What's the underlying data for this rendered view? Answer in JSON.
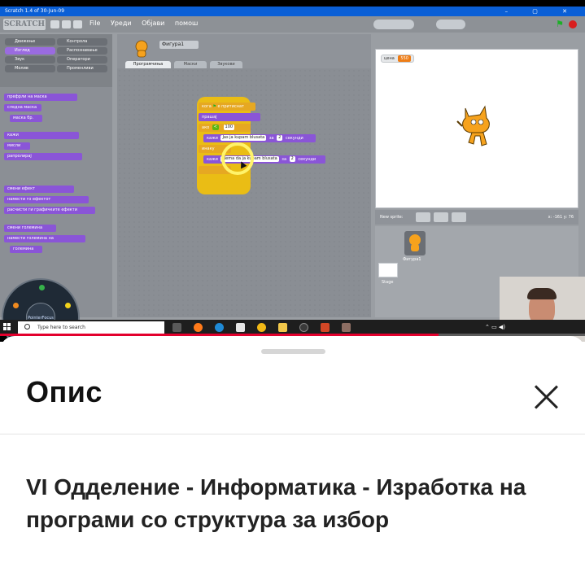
{
  "video": {
    "window_title": "Scratch 1.4 of 30-Jun-09",
    "menu": [
      "File",
      "Уреди",
      "Објави",
      "помош"
    ],
    "sprite_name": "Фигура1",
    "tabs": [
      "Програмчиња",
      "Маски",
      "Звукови"
    ],
    "palette_categories": [
      "Движење",
      "Изглед",
      "Звук",
      "Молив",
      "Контрола",
      "Распознавање",
      "Оператори",
      "Променливи"
    ],
    "palette_blocks": [
      "префрли на маска",
      "следна маска",
      "маска бр.",
      "кажи",
      "мисли",
      "рапролирај",
      "смени ефект",
      "намести го ефектот",
      "расчисти ги графичките ефекти",
      "смени големина",
      "намести големина на",
      "големина"
    ],
    "script_blocks": {
      "when": "кога",
      "clicked": "е притиснат",
      "ask": "прашај",
      "if": "ако",
      "condition_value": "100",
      "say1": "кажи",
      "say1_text": "Jas ja kupam blusata",
      "say1_for": "за",
      "say1_secs": "2",
      "say1_unit": "секунди",
      "else": "инаку",
      "say2": "кажи",
      "say2_text": "Nema da ja kupam blusata",
      "say2_for": "за",
      "say2_secs": "2",
      "say2_unit": "секунди"
    },
    "stage_monitor_label": "цена",
    "stage_monitor_value": "550",
    "new_sprite_label": "New sprite:",
    "stage_coords": "x: -161  y: 76",
    "sprite_thumb_label": "Фигура1",
    "stage_thumb_label": "Stage",
    "pointer_focus_label": "PointerFocus",
    "taskbar_search_placeholder": "Type here to search",
    "progress_percent": 75,
    "accent_colors": {
      "looks": "#8a55d7",
      "control": "#e6a822",
      "operators": "#5cb712",
      "monitor": "#ee7d16",
      "progress": "#e3002d"
    }
  },
  "sheet": {
    "title": "Опис",
    "close_icon": "close-icon",
    "description": "VI Одделение - Информатика - Изработка на програми со структура за избор"
  }
}
